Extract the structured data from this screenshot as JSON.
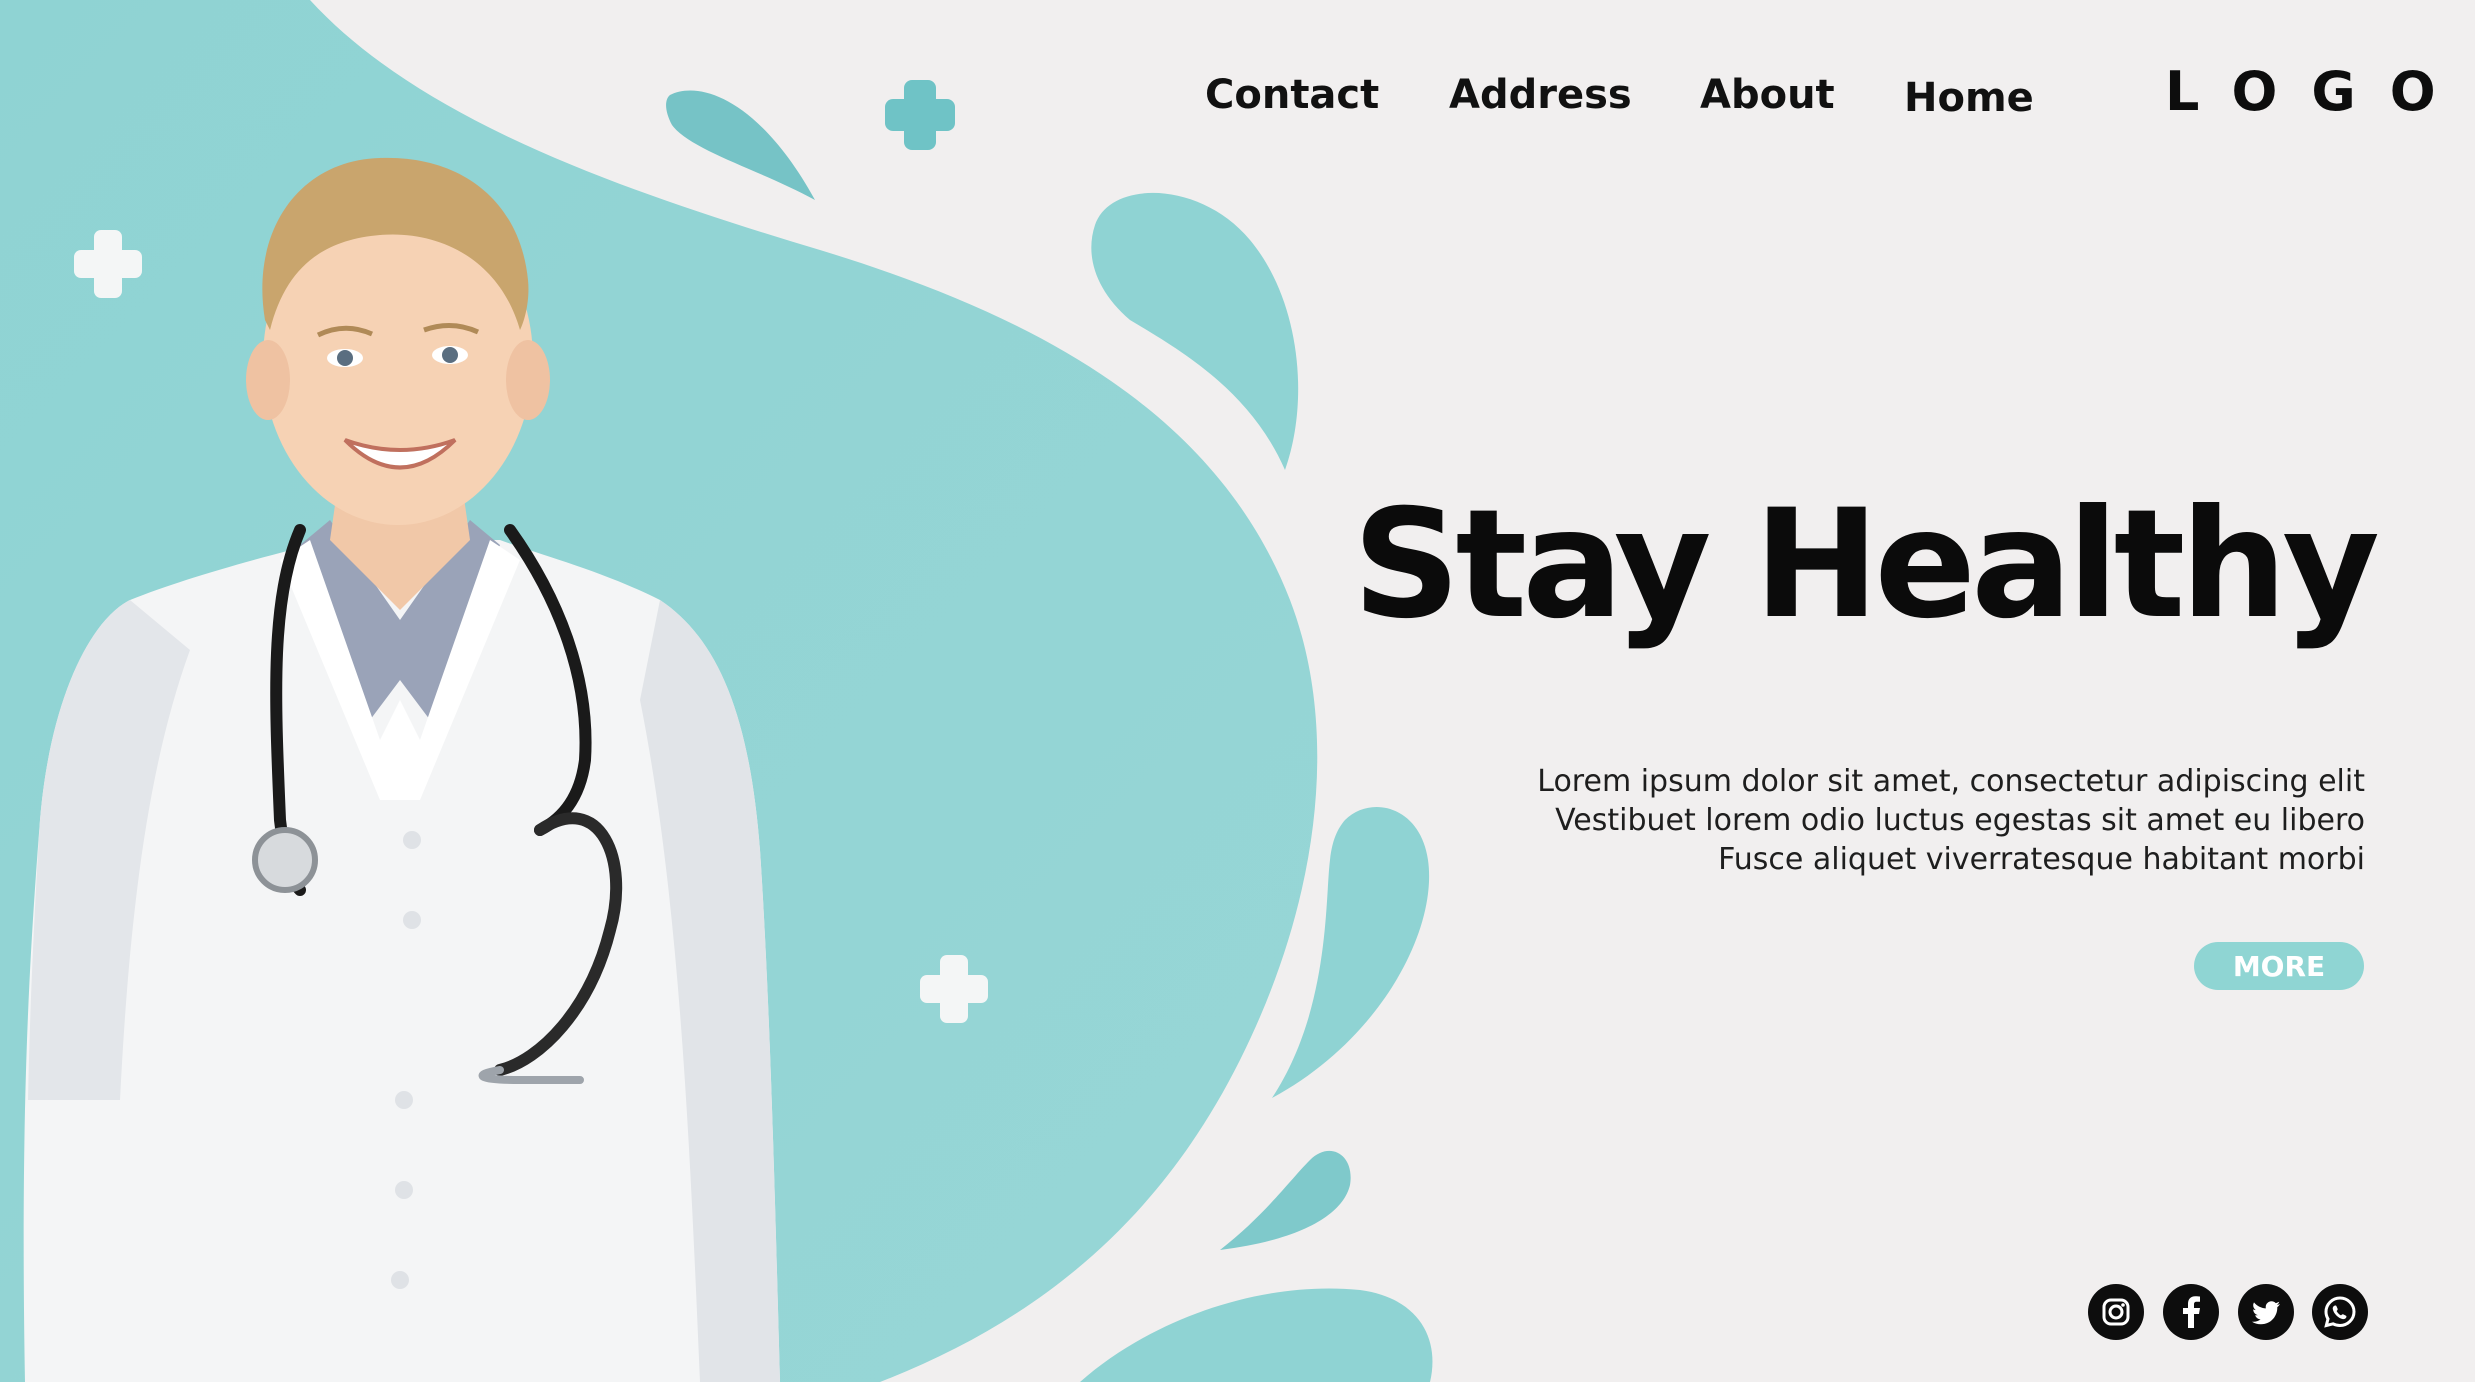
{
  "nav": {
    "items": [
      {
        "label": "Contact"
      },
      {
        "label": "Address"
      },
      {
        "label": "About"
      },
      {
        "label": "Home"
      }
    ],
    "logo": "LOGO"
  },
  "hero": {
    "title": "Stay Healthy",
    "lines": [
      "Lorem ipsum dolor sit amet, consectetur adipiscing elit",
      "Vestibuet lorem odio luctus egestas sit amet eu libero",
      "Fusce aliquet viverratesque habitant morbi"
    ],
    "more_label": "MORE"
  },
  "social": [
    {
      "icon": "instagram-icon"
    },
    {
      "icon": "facebook-icon"
    },
    {
      "icon": "twitter-icon"
    },
    {
      "icon": "whatsapp-icon"
    }
  ],
  "colors": {
    "background": "#f1efef",
    "accent": "#8fd5d3",
    "text": "#0b0b0b"
  }
}
